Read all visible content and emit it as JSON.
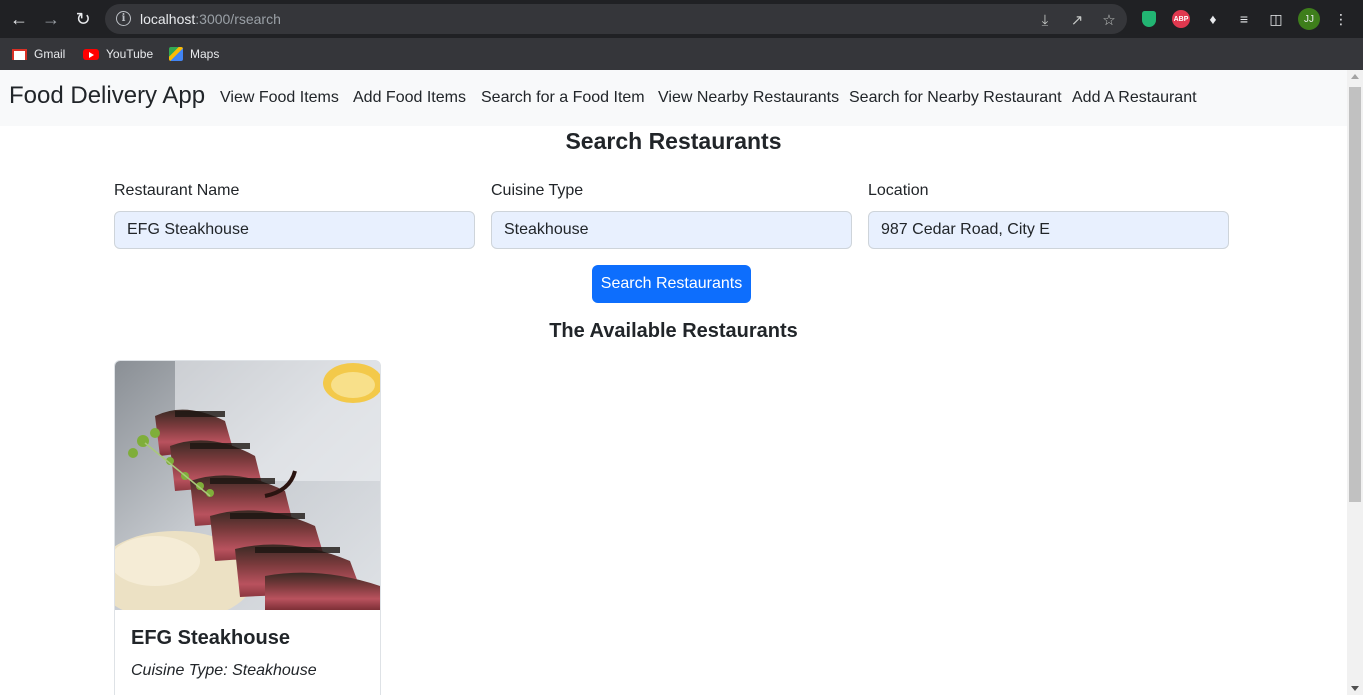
{
  "browser": {
    "url_host": "localhost",
    "url_path": ":3000/rsearch",
    "avatar_initials": "JJ",
    "bookmarks": [
      {
        "label": "Gmail",
        "icon": "gmail-icon"
      },
      {
        "label": "YouTube",
        "icon": "youtube-icon"
      },
      {
        "label": "Maps",
        "icon": "maps-icon"
      }
    ],
    "extensions": [
      "shield-extension-icon",
      "abp-icon",
      "puzzle-icon",
      "playlist-icon",
      "sidepanel-icon"
    ],
    "abp_text": "ABP"
  },
  "navbar": {
    "brand": "Food Delivery App",
    "links": [
      "View Food Items",
      "Add Food Items",
      "Search for a Food Item",
      "View Nearby Restaurants",
      "Search for Nearby Restaurant",
      "Add A Restaurant"
    ]
  },
  "search": {
    "title": "Search Restaurants",
    "fields": [
      {
        "label": "Restaurant Name",
        "value": "EFG Steakhouse"
      },
      {
        "label": "Cuisine Type",
        "value": "Steakhouse"
      },
      {
        "label": "Location",
        "value": "987 Cedar Road, City E"
      }
    ],
    "button_label": "Search Restaurants"
  },
  "results": {
    "title": "The Available Restaurants",
    "cards": [
      {
        "name": "EFG Steakhouse",
        "cuisine": "Cuisine Type: Steakhouse"
      }
    ]
  },
  "colors": {
    "primary": "#0d6efd",
    "navbar_bg": "#f8f9fa",
    "input_autofill": "#e8f0fe",
    "chrome_dark": "#202124"
  }
}
